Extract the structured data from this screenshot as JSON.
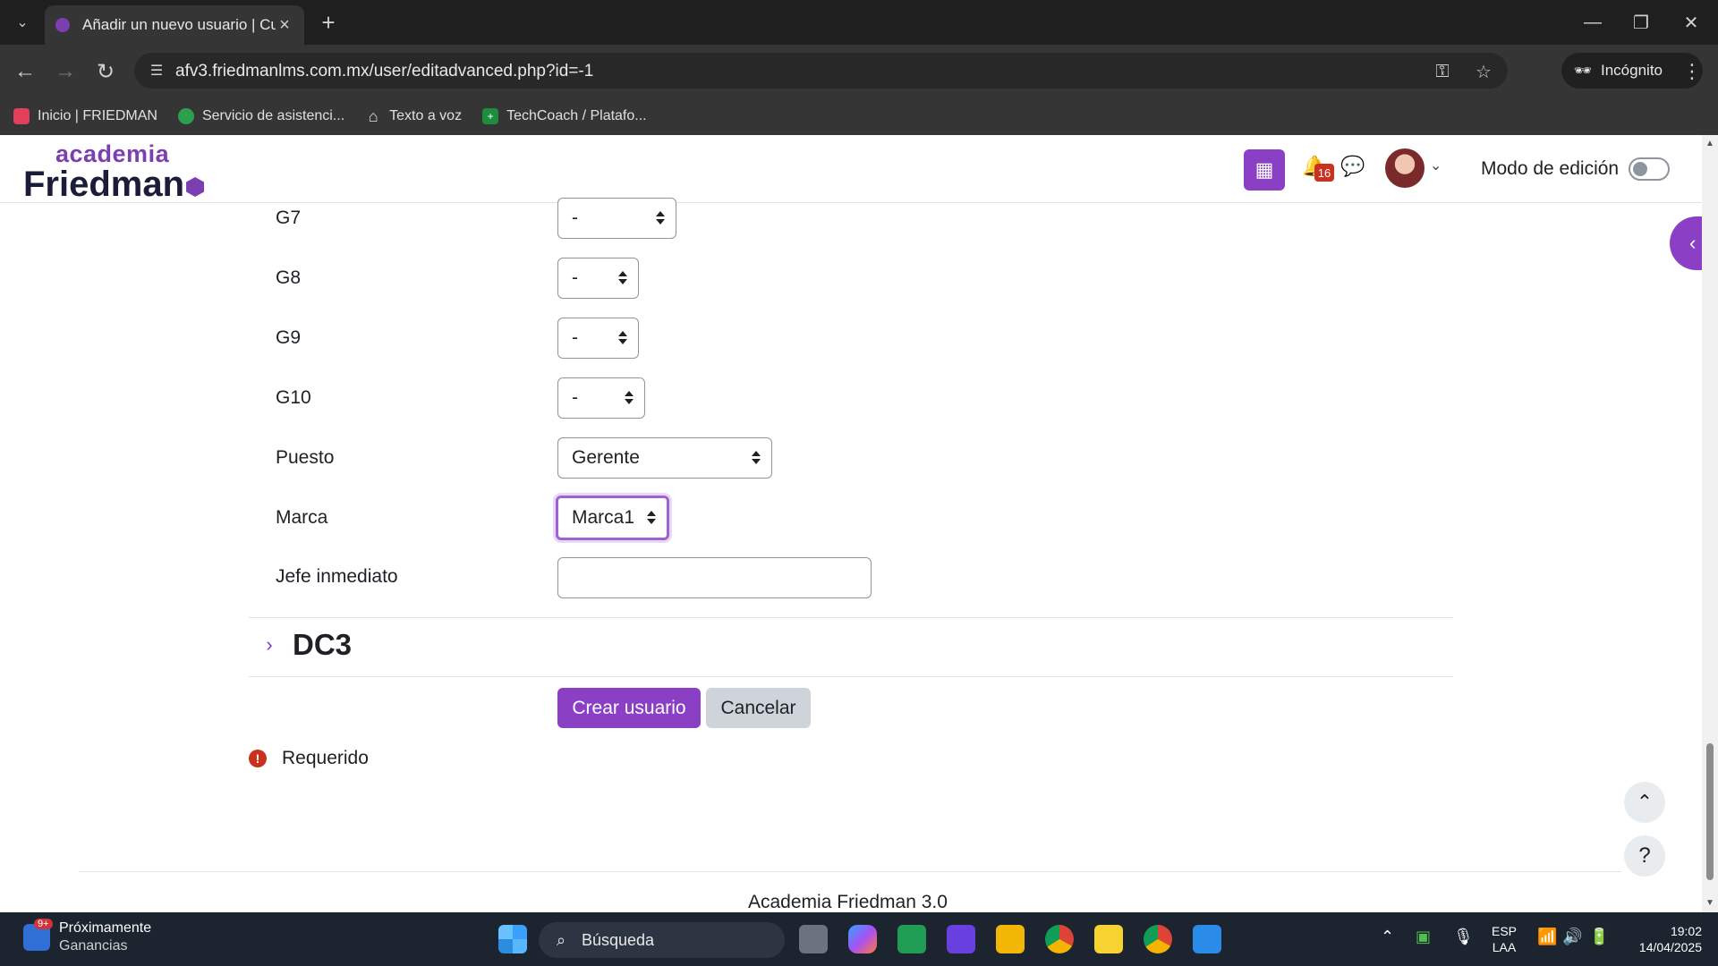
{
  "browser": {
    "tab_title": "Añadir un nuevo usuario | Cuenta",
    "url": "afv3.friedmanlms.com.mx/user/editadvanced.php?id=-1",
    "incognito_label": "Incógnito",
    "bookmarks": [
      {
        "label": "Inicio | FRIEDMAN",
        "color": "#e43f5a"
      },
      {
        "label": "Servicio de asistenci...",
        "color": "#2e9e4f"
      },
      {
        "label": "Texto a voz",
        "color": "#cfcfcf"
      },
      {
        "label": "TechCoach / Platafo...",
        "color": "#1e8e3e"
      }
    ]
  },
  "header": {
    "logo_top": "academia",
    "logo_bottom": "Friedman",
    "notification_count": "16",
    "edit_mode_label": "Modo de edición",
    "accent_color": "#8b3fc4"
  },
  "form": {
    "fields": [
      {
        "label": "G7",
        "value": "-"
      },
      {
        "label": "G8",
        "value": "-"
      },
      {
        "label": "G9",
        "value": "-"
      },
      {
        "label": "G10",
        "value": "-"
      },
      {
        "label": "Puesto",
        "value": "Gerente"
      },
      {
        "label": "Marca",
        "value": "Marca1"
      },
      {
        "label": "Jefe inmediato",
        "value": ""
      }
    ],
    "section_title": "DC3",
    "create_button": "Crear usuario",
    "cancel_button": "Cancelar",
    "required_label": "Requerido"
  },
  "footer": {
    "text": "Academia Friedman 3.0"
  },
  "taskbar": {
    "weather_badge": "9+",
    "weather_title": "Próximamente",
    "weather_subtitle": "Ganancias",
    "search_placeholder": "Búsqueda",
    "lang_top": "ESP",
    "lang_bottom": "LAA",
    "time": "19:02",
    "date": "14/04/2025"
  }
}
